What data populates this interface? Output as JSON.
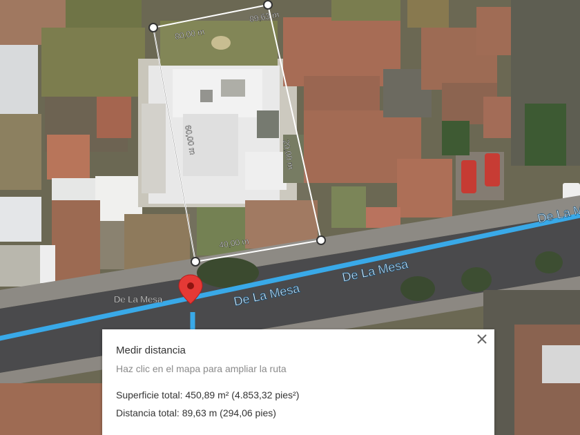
{
  "map": {
    "street_labels": [
      "De La Mesa",
      "De La Mesa",
      "De La Mesa",
      "De La M"
    ],
    "pin_label": "De La Mesa",
    "pin_color": "#e53935",
    "route_color": "#39a9e8",
    "measure_labels": {
      "top": "80,00 m",
      "top_right": "89,63 m",
      "left": "60,00 m",
      "right": "20,00 m",
      "bottom": "40,00 m"
    }
  },
  "panel": {
    "title": "Medir distancia",
    "hint": "Haz clic en el mapa para ampliar la ruta",
    "area_text": "Superficie total: 450,89 m² (4.853,32 pies²)",
    "distance_text": "Distancia total: 89,63 m (294,06 pies)",
    "close_icon": "close-icon"
  }
}
